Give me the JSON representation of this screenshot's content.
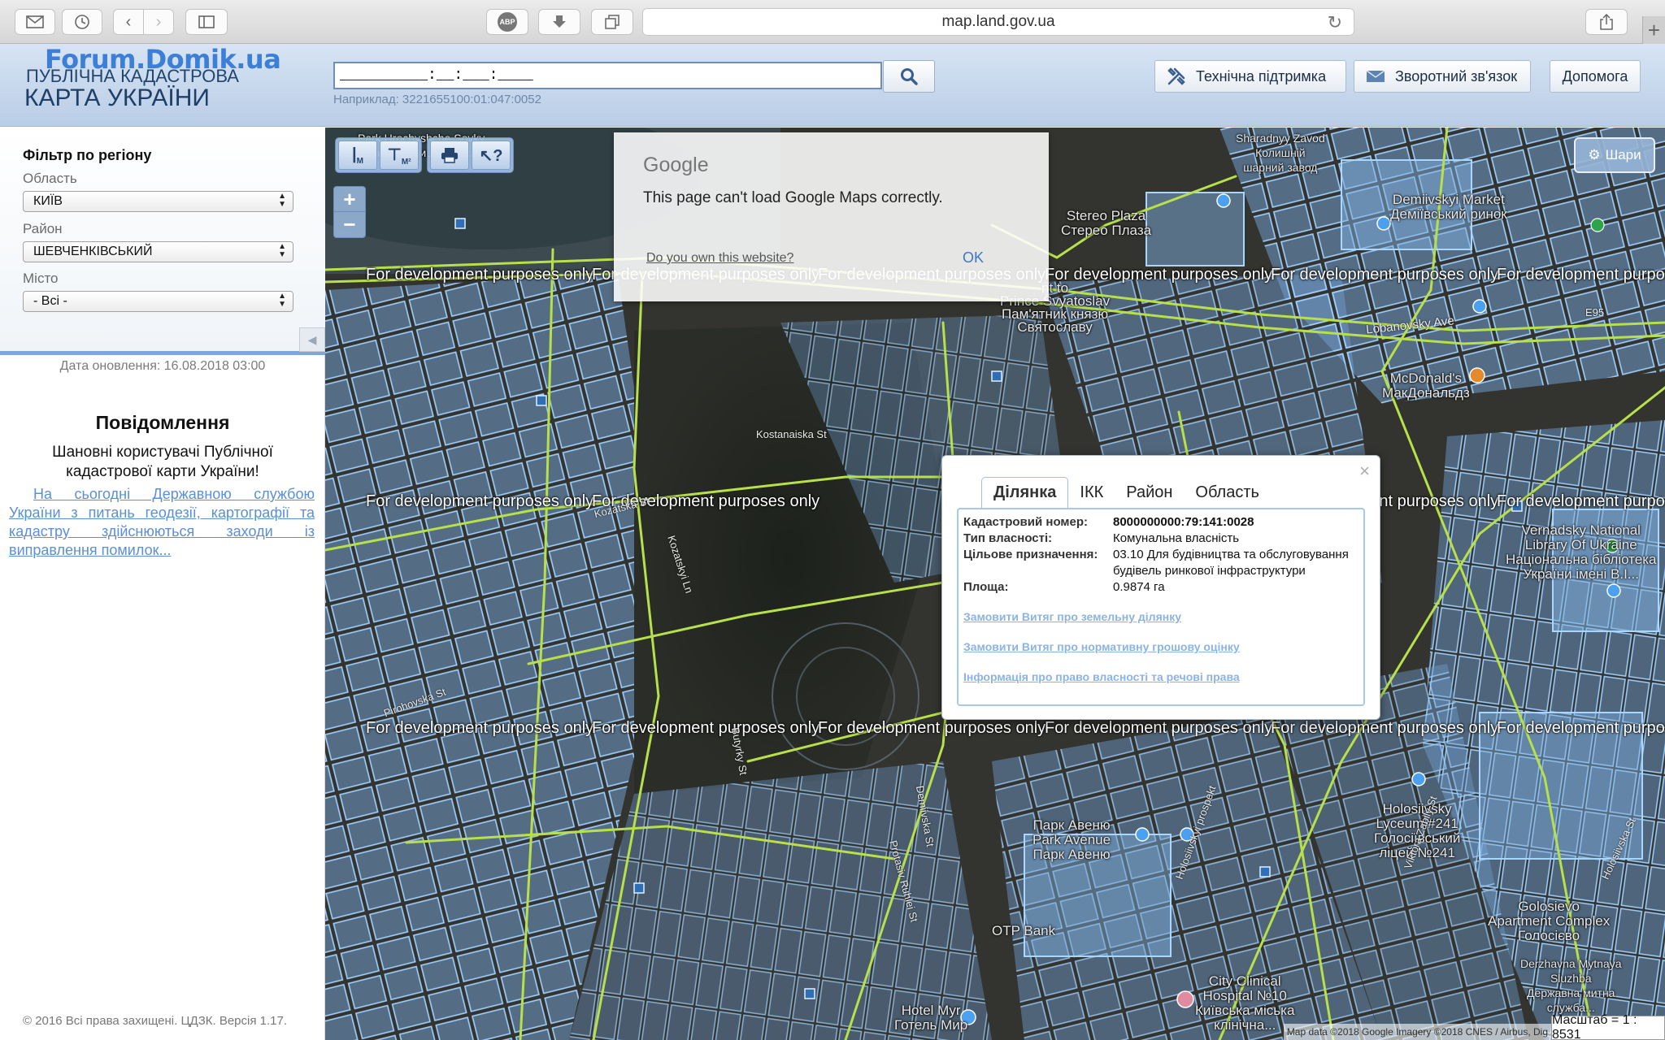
{
  "browser": {
    "url": "map.land.gov.ua",
    "buttons": [
      "mail-icon",
      "history-icon",
      "back-icon",
      "forward-icon",
      "sidebar-icon",
      "adblock-icon",
      "download-icon",
      "tabs-icon",
      "share-icon"
    ],
    "abp_label": "ABP",
    "new_tab": "+"
  },
  "header": {
    "watermark": "Forum.Domik.ua",
    "brand_line1": "ПУБЛІЧНА КАДАСТРОВА",
    "brand_line2": "КАРТА УКРАЇНИ",
    "search_value": "__________:__:___:____",
    "search_hint": "Наприклад: 3221655100:01:047:0052",
    "buttons": {
      "support": "Технічна підтримка",
      "feedback": "Зворотний зв'язок",
      "help": "Допомога"
    }
  },
  "sidebar": {
    "filter_title": "Фільтр по регіону",
    "oblast_label": "Область",
    "oblast_value": "КИЇВ",
    "rayon_label": "Район",
    "rayon_value": "ШЕВЧЕНКІВСЬКИЙ",
    "city_label": "Місто",
    "city_value": "- Всі -",
    "update_date": "Дата оновлення: 16.08.2018 03:00",
    "notice_title": "Повідомлення",
    "notice_greeting": "Шановні користувачі Публічної кадастрової карти України!",
    "notice_link": "На сьогодні Державною службою України з питань геодезії, картографії та кадастру здійснюються заходи із виправлення помилок...",
    "copyright": "© 2016 Всі права захищені. ЦДЗК. Версія 1.17."
  },
  "map": {
    "toolbar": [
      "М",
      "М²"
    ],
    "zoom_in": "+",
    "zoom_out": "−",
    "layers_label": "Шари",
    "dev_watermark": "For development purposes only",
    "gmaps_error": {
      "logo": "Google",
      "message": "This page can't load Google Maps correctly.",
      "own_link": "Do you own this website?",
      "ok": "OK"
    },
    "places": {
      "stereo_plaza": "Stereo Plaza\nСтерео Плаза",
      "demiivsky_market": "Demiivskyi Market\nДеміївський ринок",
      "svyatoslav": "nt to\nPrince Svyatoslav\nПам'ятник князю\nСвятославу",
      "mcdonalds": "McDonald's\nМакДональдз",
      "vernadsky": "Vernadsky National\nLibrary Of Ukraine\nНаціональна бібліотека\nУкраїни імені В.І...",
      "park_avenue": "Парк Авеню\nPark Avenue\nПарк Авеню",
      "holosiivsky_lyceum": "Holosiivsky\nLyceum #241\nГолосіївський\nліцей №241",
      "golosievo": "Golosievo\nApartment Complex\nГолосієво",
      "otp_bank": "OTP Bank",
      "city_hospital": "City Clinical\nHospital №10\nКиївська міська\nклінічна...",
      "hotel_myr": "Hotel Myr\nГотель Мир",
      "derzhavna": "Derzhavna Mytnaya\nSluzhba\nДержавна митна\nслужба...",
      "kolyshniy": "Sharadnyy Zavod\nКолишній\nшарний завод",
      "park_urochyshche": "Park Urochyshche Sovky\nПарк Урочище Совки"
    },
    "streets": {
      "kostanaiska": "Kostanaiska St",
      "lobanovsky": "Lobanovsky Ave",
      "e95": "E95",
      "demiivska": "Demiivska St",
      "holosiivskyi_prospekt": "Holosiivskyi prospekt",
      "holosiivska": "Holosiivska St",
      "kozatska": "Kozatska St",
      "kozatskyi_ln": "Kozatskyi Ln",
      "pirohovska": "Pirohovska St",
      "butyrky": "Butyrky St",
      "viktora_zabily": "Viktora Zabily St",
      "pronatova": "Protasiv Ruhlei St"
    },
    "popup": {
      "tabs": [
        "Ділянка",
        "ІКК",
        "Район",
        "Область"
      ],
      "cad_label": "Кадастровий номер:",
      "cad_value": "8000000000:79:141:0028",
      "owner_label": "Тип власності:",
      "owner_value": "Комунальна власність",
      "purpose_label": "Цільове призначення:",
      "purpose_value": "03.10 Для будівництва та обслуговування будівель ринкової інфраструктури",
      "area_label": "Площа:",
      "area_value": "0.9874 га",
      "links": [
        "Замовити Витяг про земельну ділянку",
        "Замовити Витяг про нормативну грошову оцінку",
        "Інформація про право власності та речові права"
      ]
    },
    "attribution": "Map data ©2018 Google Imagery ©2018 CNES / Airbus, Dig",
    "scale": "Масштаб = 1 : 8531"
  }
}
